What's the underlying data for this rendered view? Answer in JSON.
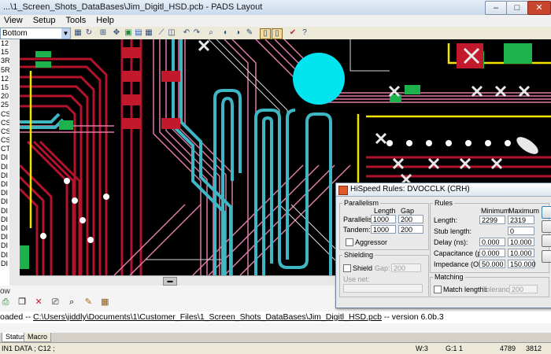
{
  "window": {
    "title": "...\\1_Screen_Shots_DataBases\\Jim_Digitl_HSD.pcb - PADS Layout"
  },
  "menu": [
    "View",
    "Setup",
    "Tools",
    "Help"
  ],
  "toolbar": {
    "layer": "Bottom"
  },
  "layer_list": [
    "12",
    "15",
    "3R",
    "5R",
    "12",
    "15",
    "20",
    "25",
    "CS",
    "CS",
    "CS",
    "CS",
    "CT",
    "DI",
    "DI",
    "DI",
    "DI",
    "DI",
    "DI",
    "DI",
    "DI",
    "DI",
    "DI",
    "DI",
    "DI",
    "DI"
  ],
  "output": {
    "label": "ow",
    "line_prefix": "oaded -- ",
    "path": "C:\\Users\\jiddly\\Documents\\1\\Customer_Files\\1_Screen_Shots_DataBases\\Jim_Digitl_HSD.pcb",
    "line_suffix": " -- version 6.0b.3"
  },
  "tabs": [
    "Status",
    "Macro"
  ],
  "status": {
    "net": "IN1 DATA ; C12 ;",
    "w": "W:3",
    "g": "G:1 1",
    "x": "4789",
    "y": "3812"
  },
  "dialog": {
    "title": "HiSpeed Rules: DVOCCLK  (CRH)",
    "parallelism": {
      "group": "Parallelism",
      "length_header": "Length",
      "gap_header": "Gap",
      "rows": [
        {
          "label": "Parallelism:",
          "length": "1000",
          "gap": "200"
        },
        {
          "label": "Tandem:",
          "length": "1000",
          "gap": "200"
        }
      ],
      "aggressor": "Aggressor"
    },
    "shielding": {
      "group": "Shielding",
      "shield": "Shield",
      "gap_label": "Gap:",
      "gap": "200",
      "use_net": "Use net:"
    },
    "rules": {
      "group": "Rules",
      "min_header": "Minimum",
      "max_header": "Maximum",
      "rows": [
        {
          "label": "Length:",
          "min": "2299",
          "max": "2319"
        },
        {
          "label": "Stub length:",
          "max": "0"
        },
        {
          "label": "Delay (ns):",
          "min": "0.000",
          "max": "10.000"
        },
        {
          "label": "Capacitance (pF):",
          "min": "0.000",
          "max": "10.000"
        },
        {
          "label": "Impedance (Ohm):",
          "min": "50.000",
          "max": "150.000"
        }
      ]
    },
    "matching": {
      "group": "Matching",
      "match": "Match lengths",
      "tol_label": "Tolerance:",
      "tol": "200"
    }
  },
  "colors": {
    "board_bg": "#000000",
    "red_trace": "#b5122b",
    "pink_trace": "#e07aa6",
    "cyan_trace": "#3fb6c4",
    "yellow": "#f2e600",
    "green_pad": "#1db24b",
    "via": "#00e5ef"
  }
}
